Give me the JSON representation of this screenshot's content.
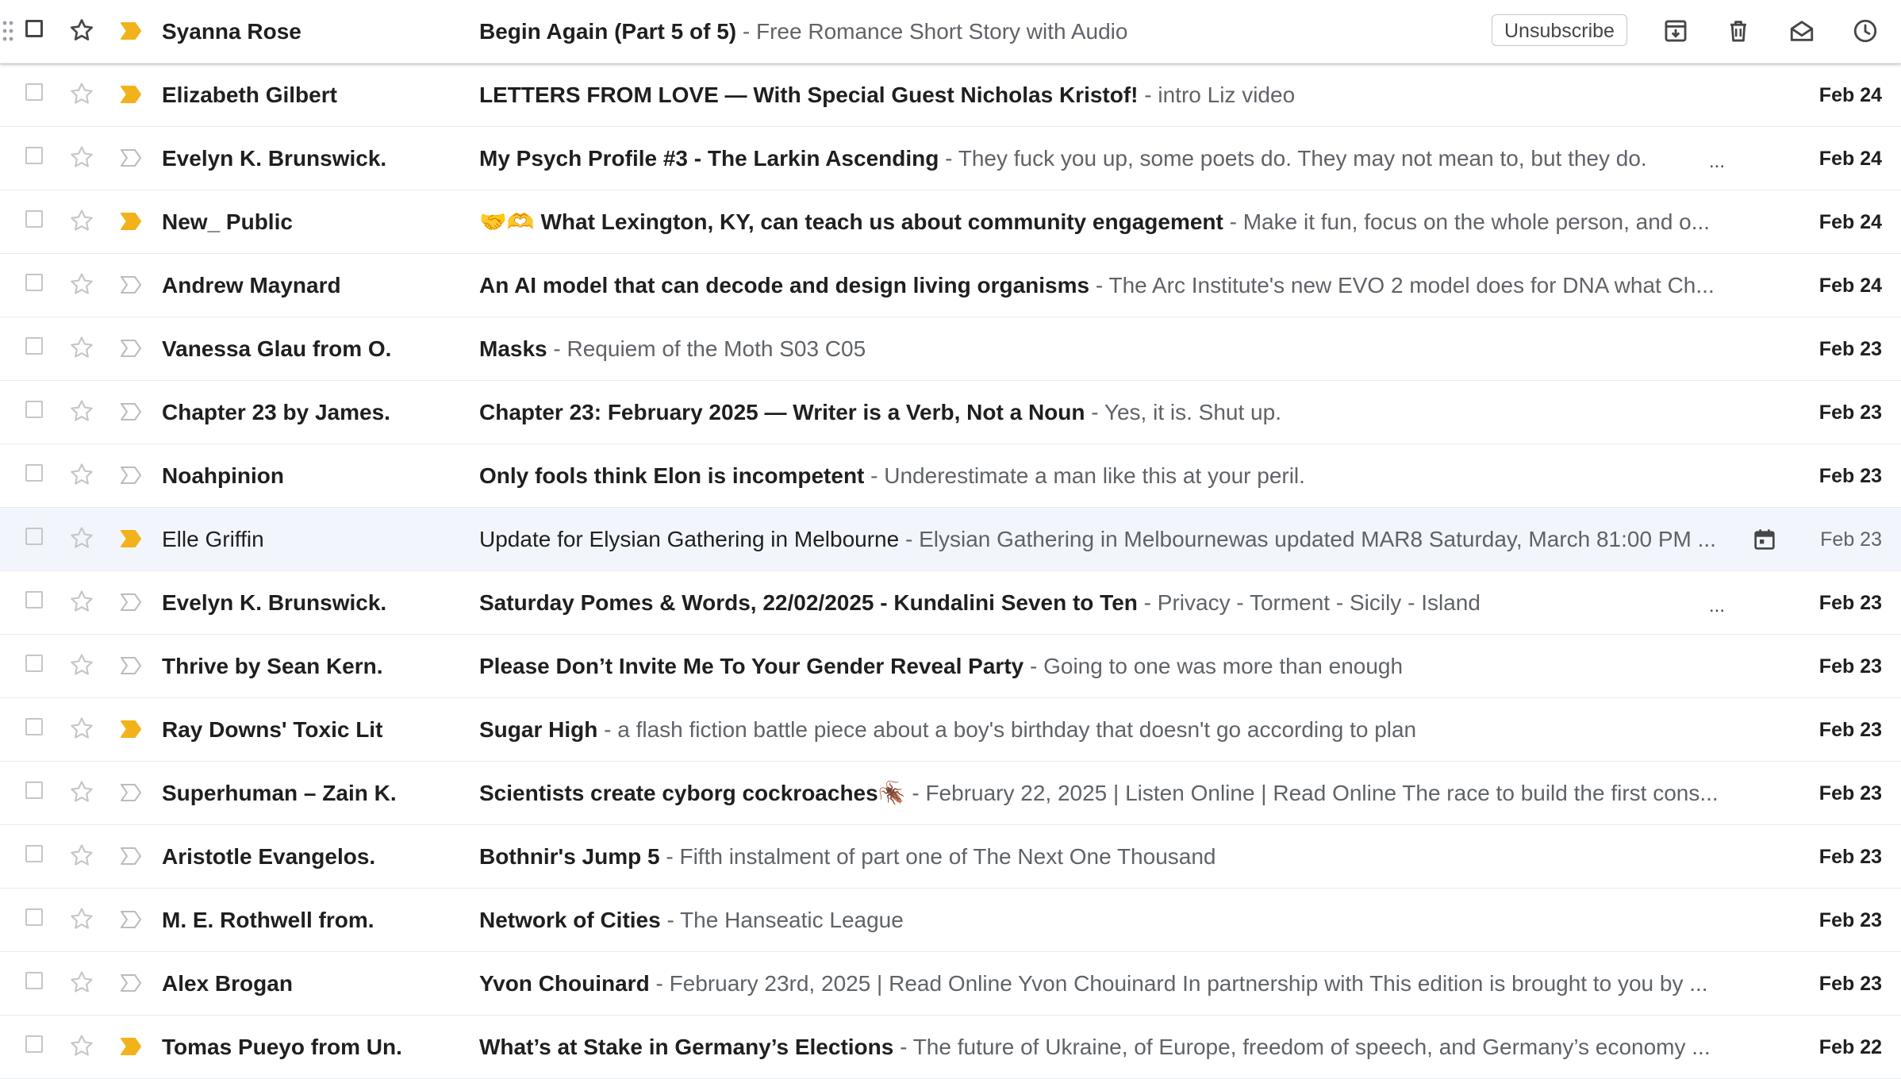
{
  "hover_actions": {
    "unsubscribe_label": "Unsubscribe"
  },
  "emails": [
    {
      "sender": "Syanna Rose",
      "subject": "Begin Again (Part 5 of 5)",
      "snippet": " - Free Romance Short Story with Audio",
      "date": "",
      "important": true,
      "unread": true,
      "hovered": true
    },
    {
      "sender": "Elizabeth Gilbert",
      "subject": "LETTERS FROM LOVE — With Special Guest Nicholas Kristof!",
      "snippet": " - intro Liz video",
      "date": "Feb 24",
      "important": true,
      "unread": true
    },
    {
      "sender": "Evelyn K. Brunswick.",
      "subject": "My Psych Profile #3 - The Larkin Ascending",
      "snippet": " - They fuck you up, some poets do. They may not mean to, but they do.",
      "date": "Feb 24",
      "important": false,
      "unread": true,
      "dots": "..."
    },
    {
      "sender": "New_ Public",
      "subject": "🤝🫶 What Lexington, KY, can teach us about community engagement",
      "snippet": " - Make it fun, focus on the whole person, and o...",
      "date": "Feb 24",
      "important": true,
      "unread": true
    },
    {
      "sender": "Andrew Maynard",
      "subject": "An AI model that can decode and design living organisms",
      "snippet": " - The Arc Institute's new EVO 2 model does for DNA what Ch...",
      "date": "Feb 24",
      "important": false,
      "unread": true
    },
    {
      "sender": "Vanessa Glau from O.",
      "subject": "Masks",
      "snippet": " - Requiem of the Moth S03 C05",
      "date": "Feb 23",
      "important": false,
      "unread": true
    },
    {
      "sender": "Chapter 23 by James.",
      "subject": "Chapter 23: February 2025 — Writer is a Verb, Not a Noun",
      "snippet": " - Yes, it is. Shut up.",
      "date": "Feb 23",
      "important": false,
      "unread": true
    },
    {
      "sender": "Noahpinion",
      "subject": "Only fools think Elon is incompetent",
      "snippet": " - Underestimate a man like this at your peril.",
      "date": "Feb 23",
      "important": false,
      "unread": true
    },
    {
      "sender": "Elle Griffin",
      "subject": "Update for Elysian Gathering in Melbourne",
      "snippet": " - Elysian Gathering in Melbournewas updated MAR8 Saturday, March 81:00 PM ...",
      "date": "Feb 23",
      "important": true,
      "unread": false,
      "calendar": true
    },
    {
      "sender": "Evelyn K. Brunswick.",
      "subject": "Saturday Pomes & Words, 22/02/2025 - Kundalini Seven to Ten",
      "snippet": " - Privacy - Torment - Sicily - Island",
      "date": "Feb 23",
      "important": false,
      "unread": true,
      "dots": "..."
    },
    {
      "sender": "Thrive by Sean Kern.",
      "subject": "Please Don’t Invite Me To Your Gender Reveal Party",
      "snippet": " - Going to one was more than enough",
      "date": "Feb 23",
      "important": false,
      "unread": true
    },
    {
      "sender": "Ray Downs' Toxic Lit",
      "subject": "Sugar High",
      "snippet": " - a flash fiction battle piece about a boy's birthday that doesn't go according to plan",
      "date": "Feb 23",
      "important": true,
      "unread": true
    },
    {
      "sender": "Superhuman – Zain K.",
      "subject": "Scientists create cyborg cockroaches🪳",
      "snippet": " - February 22, 2025 | Listen Online | Read Online The race to build the first cons...",
      "date": "Feb 23",
      "important": false,
      "unread": true
    },
    {
      "sender": "Aristotle Evangelos.",
      "subject": "Bothnir's Jump 5",
      "snippet": " - Fifth instalment of part one of The Next One Thousand",
      "date": "Feb 23",
      "important": false,
      "unread": true
    },
    {
      "sender": "M. E. Rothwell from.",
      "subject": "Network of Cities",
      "snippet": " - The Hanseatic League",
      "date": "Feb 23",
      "important": false,
      "unread": true
    },
    {
      "sender": "Alex Brogan",
      "subject": "Yvon Chouinard",
      "snippet": " - February 23rd, 2025 | Read Online Yvon Chouinard In partnership with This edition is brought to you by ...",
      "date": "Feb 23",
      "important": false,
      "unread": true
    },
    {
      "sender": "Tomas Pueyo from Un.",
      "subject": "What’s at Stake in Germany’s Elections",
      "snippet": " - The future of Ukraine, of Europe, freedom of speech, and Germany’s economy ...",
      "date": "Feb 22",
      "important": true,
      "unread": true
    }
  ]
}
